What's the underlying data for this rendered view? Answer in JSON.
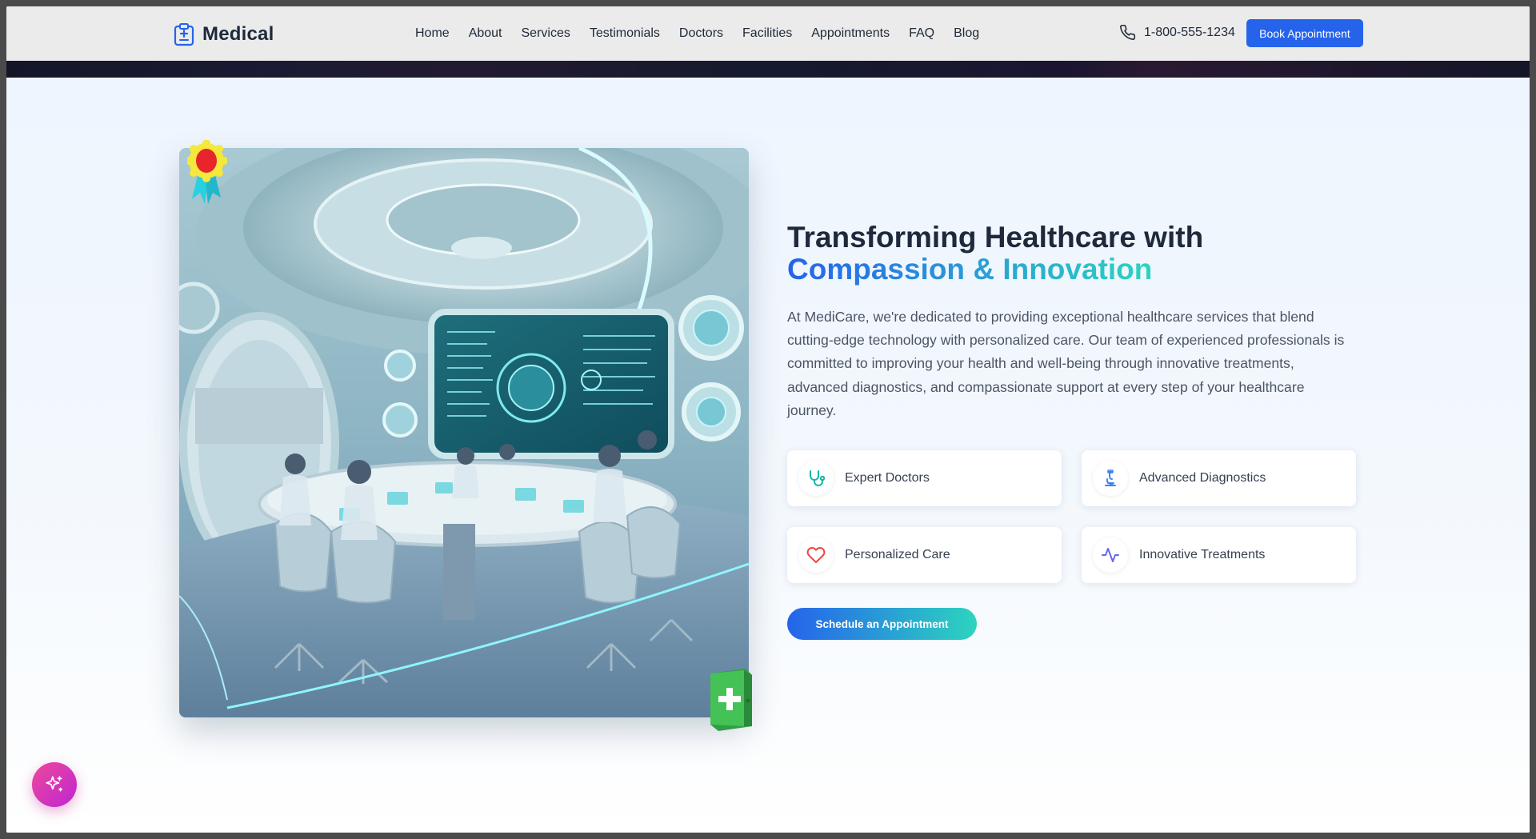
{
  "header": {
    "logo_text": "Medical",
    "nav": [
      "Home",
      "About",
      "Services",
      "Testimonials",
      "Doctors",
      "Facilities",
      "Appointments",
      "FAQ",
      "Blog"
    ],
    "phone": "1-800-555-1234",
    "book_button": "Book Appointment"
  },
  "hero": {
    "heading_line1": "Transforming Healthcare with",
    "heading_part1": "Compassion & Innovation",
    "description": "At MediCare, we're dedicated to providing exceptional healthcare services that blend cutting-edge technology with personalized care. Our team of experienced professionals is committed to improving your health and well-being through innovative treatments, advanced diagnostics, and compassionate support at every step of your healthcare journey.",
    "features": [
      {
        "label": "Expert Doctors",
        "icon": "stethoscope-icon",
        "color": "#14b8a6"
      },
      {
        "label": "Advanced Diagnostics",
        "icon": "microscope-icon",
        "color": "#3b82f6"
      },
      {
        "label": "Personalized Care",
        "icon": "heart-icon",
        "color": "#ef4444"
      },
      {
        "label": "Innovative Treatments",
        "icon": "activity-icon",
        "color": "#6366f1"
      }
    ],
    "cta": "Schedule an Appointment"
  },
  "colors": {
    "primary": "#2563eb",
    "accent": "#2dd4bf",
    "fab": "#d946ef"
  }
}
